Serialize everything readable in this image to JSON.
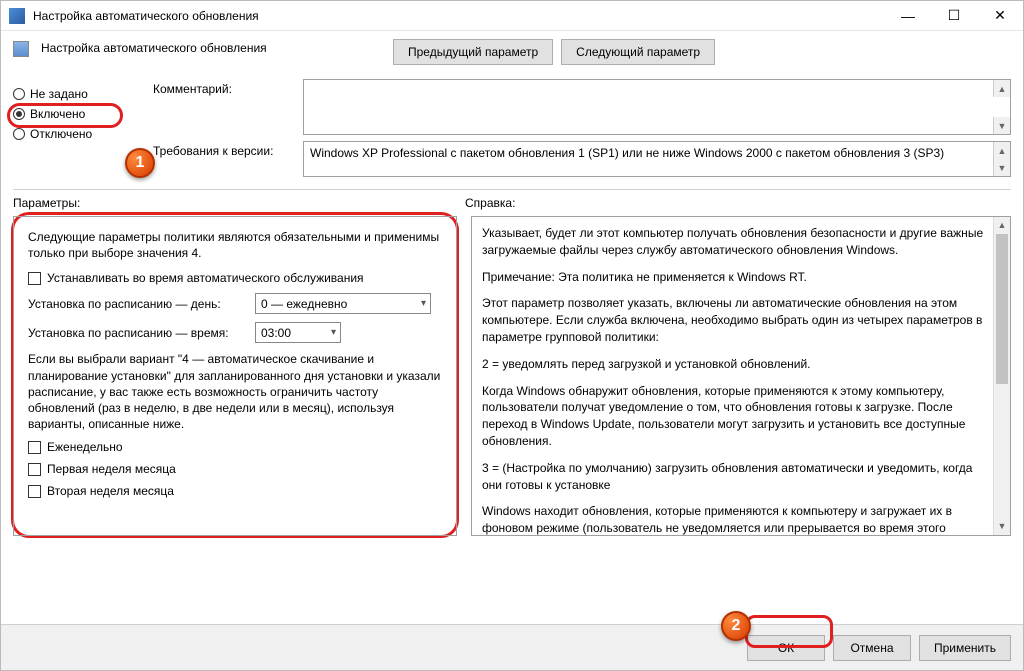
{
  "window": {
    "title": "Настройка автоматического обновления"
  },
  "header": {
    "title": "Настройка автоматического обновления",
    "prev": "Предыдущий параметр",
    "next": "Следующий параметр"
  },
  "radios": {
    "not_set": "Не задано",
    "enabled": "Включено",
    "disabled": "Отключено"
  },
  "form": {
    "comment_label": "Комментарий:",
    "req_label": "Требования к версии:",
    "req_text": "Windows XP Professional с пакетом обновления 1 (SP1) или не ниже Windows 2000 с пакетом обновления 3 (SP3)"
  },
  "sections": {
    "params": "Параметры:",
    "help": "Справка:"
  },
  "params": {
    "note": "Следующие параметры политики являются обязательными и применимы только при выборе значения 4.",
    "chk_maint": "Устанавливать во время автоматического обслуживания",
    "day_label": "Установка по расписанию — день:",
    "day_value": "0 — ежедневно",
    "time_label": "Установка по расписанию — время:",
    "time_value": "03:00",
    "para2": "Если вы выбрали вариант \"4 — автоматическое скачивание и планирование установки\" для запланированного дня установки и указали расписание, у вас также есть возможность ограничить частоту обновлений (раз в неделю, в две недели или в месяц), используя варианты, описанные ниже.",
    "chk_weekly": "Еженедельно",
    "chk_week1": "Первая неделя месяца",
    "chk_week2": "Вторая неделя месяца"
  },
  "help": {
    "p1": "Указывает, будет ли этот компьютер получать обновления безопасности и другие важные загружаемые файлы через службу автоматического обновления Windows.",
    "p2": "Примечание: Эта политика не применяется к Windows RT.",
    "p3": "Этот параметр позволяет указать, включены ли автоматические обновления на этом компьютере. Если служба включена, необходимо выбрать один из четырех параметров в параметре групповой политики:",
    "p4": "2 = уведомлять перед загрузкой и установкой обновлений.",
    "p5": "Когда Windows обнаружит обновления, которые применяются к этому компьютеру, пользователи получат уведомление о том, что обновления готовы к загрузке. После переход в Windows Update, пользователи могут загрузить и установить все доступные обновления.",
    "p6": "3 = (Настройка по умолчанию) загрузить обновления автоматически и уведомить, когда они готовы к установке",
    "p7": "Windows находит обновления, которые применяются к компьютеру и загружает их в фоновом режиме (пользователь не уведомляется или прерывается во время этого"
  },
  "footer": {
    "ok": "ОК",
    "cancel": "Отмена",
    "apply": "Применить"
  },
  "markers": {
    "m1": "1",
    "m2": "2"
  }
}
